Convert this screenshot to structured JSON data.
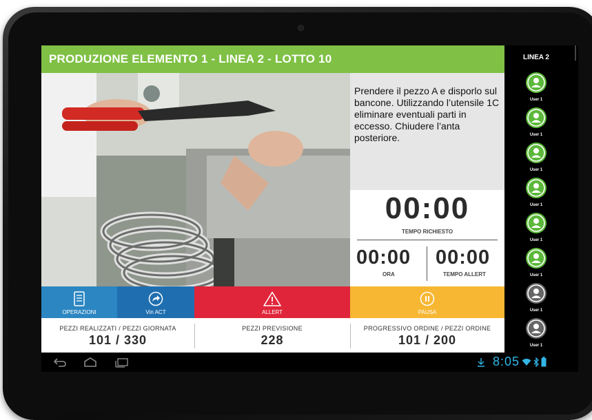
{
  "header": {
    "title": "PRODUZIONE ELEMENTO 1 - LINEA 2 - LOTTO 10"
  },
  "instructions": {
    "text": "Prendere il pezzo A e disporlo sul bancone. Utilizzando l’utensile 1C eliminare eventuali parti in eccesso. Chiudere l’anta posteriore."
  },
  "timers": {
    "required": {
      "value": "00:00",
      "label": "TEMPO RICHIESTO"
    },
    "ora": {
      "value": "00:00",
      "label": "ORA"
    },
    "allert": {
      "value": "00:00",
      "label": "TEMPO ALLERT"
    }
  },
  "actions": {
    "operazioni": {
      "label": "OPERAZIONI",
      "icon": "document-list-icon",
      "color": "#2b86c1"
    },
    "vin_act": {
      "label": "Vin ACT",
      "icon": "share-arrow-icon",
      "color": "#1f6fb0"
    },
    "allert": {
      "label": "ALLERT",
      "icon": "warning-icon",
      "color": "#e0253a"
    },
    "pausa": {
      "label": "PAUSA",
      "icon": "pause-icon",
      "color": "#f7b733"
    }
  },
  "stats": {
    "realizzati": {
      "label": "PEZZI REALIZZATI / PEZZI GIORNATA",
      "value": "101 / 330"
    },
    "previsione": {
      "label": "PEZZI PREVISIONE",
      "value": "228"
    },
    "ordine": {
      "label": "PROGRESSIVO ORDINE / PEZZI ORDINE",
      "value": "101 / 200"
    }
  },
  "sidebar": {
    "title": "LINEA 2",
    "users": [
      {
        "name": "User 1",
        "status": "active",
        "color": "#5cb83a"
      },
      {
        "name": "User 1",
        "status": "active",
        "color": "#5cb83a"
      },
      {
        "name": "User 1",
        "status": "active",
        "color": "#5cb83a"
      },
      {
        "name": "User 1",
        "status": "active",
        "color": "#5cb83a"
      },
      {
        "name": "User 1",
        "status": "active",
        "color": "#5cb83a"
      },
      {
        "name": "User 1",
        "status": "active",
        "color": "#5cb83a"
      },
      {
        "name": "User 1",
        "status": "inactive",
        "color": "#666666"
      },
      {
        "name": "User 1",
        "status": "inactive",
        "color": "#666666"
      }
    ]
  },
  "system_bar": {
    "time": "8:05",
    "accent": "#33b5e5"
  }
}
